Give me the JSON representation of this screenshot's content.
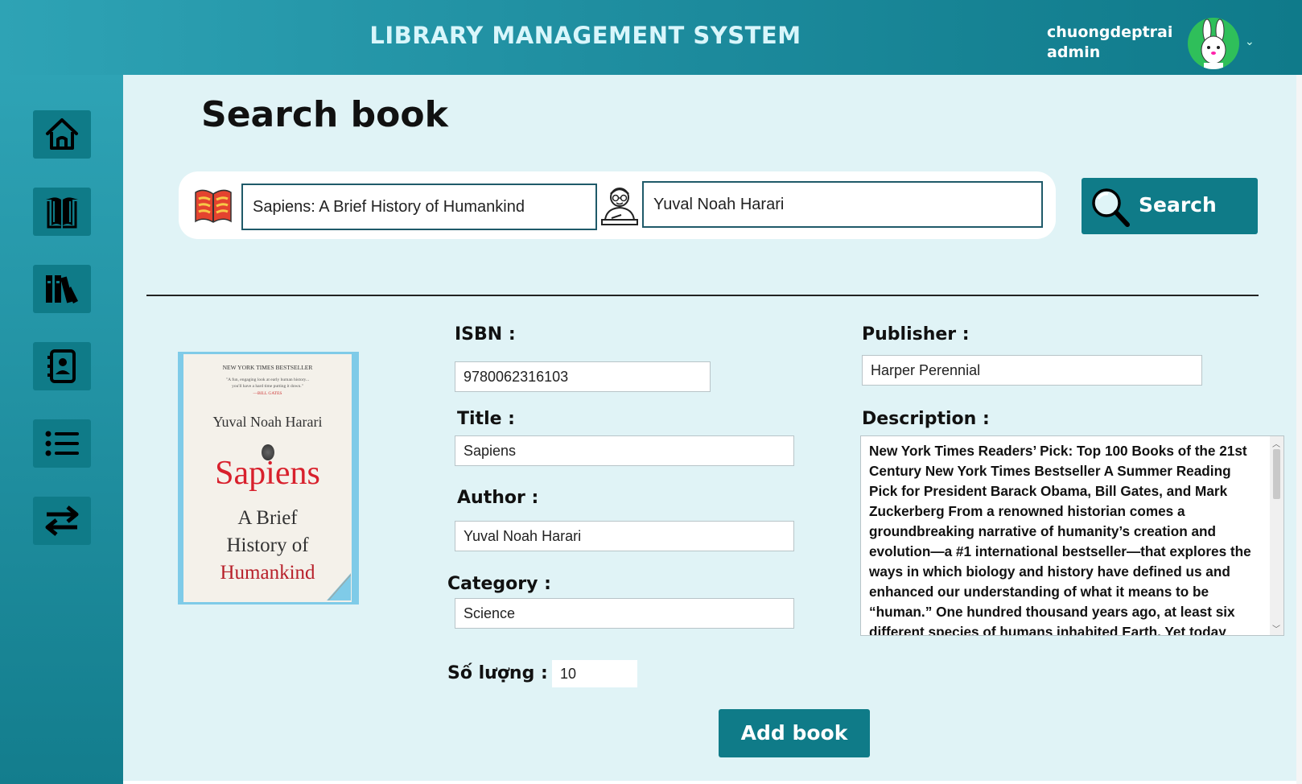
{
  "header": {
    "app_title": "LIBRARY MANAGEMENT SYSTEM",
    "username": "chuongdeptrai",
    "role": "admin",
    "avatar_icon": "rabbit-avatar-icon",
    "menu_icon": "chevron-down-icon"
  },
  "sidebar": {
    "items": [
      {
        "name": "home",
        "icon": "home-icon"
      },
      {
        "name": "books",
        "icon": "open-book-icon"
      },
      {
        "name": "library",
        "icon": "bookshelf-icon"
      },
      {
        "name": "contacts",
        "icon": "contact-book-icon"
      },
      {
        "name": "list",
        "icon": "list-icon"
      },
      {
        "name": "transactions",
        "icon": "swap-arrows-icon"
      }
    ]
  },
  "page": {
    "title": "Search book"
  },
  "search": {
    "title_value": "Sapiens: A Brief History of Humankind",
    "author_value": "Yuval Noah Harari",
    "button_label": "Search"
  },
  "cover": {
    "top_banner": "NEW YORK TIMES BESTSELLER",
    "blurb": "\"A fun, engaging look at early human history...",
    "blurb2": "you'll have a hard time putting it down.\"",
    "blurb_attr": "—BILL GATES",
    "author": "Yuval Noah Harari",
    "title": "Sapiens",
    "subtitle1": "A Brief",
    "subtitle2": "History of",
    "subtitle3": "Humankind"
  },
  "details": {
    "isbn_label": "ISBN :",
    "isbn_value": "9780062316103",
    "title_label": "Title :",
    "title_value": "Sapiens",
    "author_label": "Author :",
    "author_value": "Yuval Noah Harari",
    "category_label": "Category :",
    "category_value": "Science",
    "quantity_label": "Số lượng :",
    "quantity_value": "10",
    "publisher_label": "Publisher :",
    "publisher_value": "Harper Perennial",
    "description_label": "Description :",
    "description_value": "New York Times Readers’ Pick: Top 100 Books of the 21st Century New York Times Bestseller A Summer Reading Pick for President Barack Obama, Bill Gates, and Mark Zuckerberg From a renowned historian comes a groundbreaking narrative of humanity’s creation and evolution—a #1 international bestseller—that explores the ways in which biology and history have defined us and enhanced our understanding of what it means to be “human.” One hundred thousand years ago, at least six different species of humans inhabited Earth. Yet today"
  },
  "actions": {
    "add_label": "Add book"
  },
  "colors": {
    "primary": "#0f7b88",
    "header": "#1c8a9c",
    "content_bg": "#e0f3f6"
  }
}
